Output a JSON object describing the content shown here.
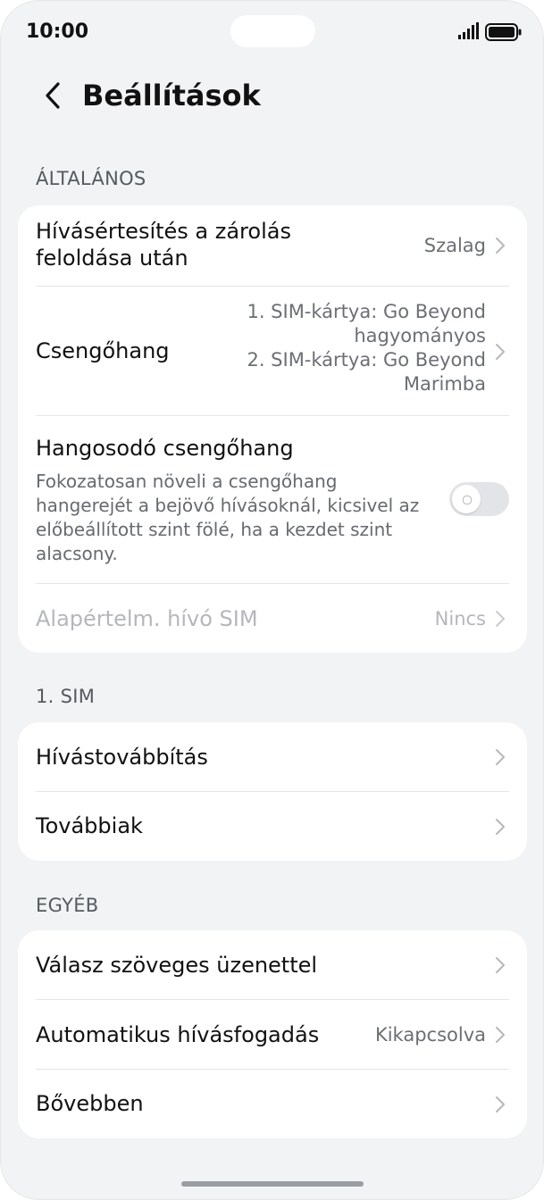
{
  "status_bar": {
    "time": "10:00",
    "signal_icon": "cellular-signal-icon",
    "battery_icon": "battery-full-icon"
  },
  "header": {
    "title": "Beállítások",
    "back_icon": "chevron-left-icon"
  },
  "sections": {
    "general": {
      "label": "ÁLTALÁNOS",
      "items": {
        "notification": {
          "title_line1": "Hívásértesítés a zárolás",
          "title_line2": "feloldása után",
          "value": "Szalag"
        },
        "ringtone": {
          "title": "Csengőhang",
          "value_line1": "1. SIM-kártya: Go Beyond",
          "value_line2": "hagyományos",
          "value_line3": "2. SIM-kártya: Go Beyond",
          "value_line4": "Marimba"
        },
        "rising_ringtone": {
          "title": "Hangosodó csengőhang",
          "desc_line1": "Fokozatosan növeli a csengőhang",
          "desc_line2": "hangerejét a bejövő hívásoknál, kicsivel az",
          "desc_line3": "előbeállított szint fölé, ha a kezdet szint",
          "desc_line4": "alacsony.",
          "enabled": false
        },
        "default_sim": {
          "title": "Alapértelm. hívó SIM",
          "value": "Nincs"
        }
      }
    },
    "sim1": {
      "label": "1. SIM",
      "items": {
        "forwarding": {
          "title": "Hívástovábbítás"
        },
        "more": {
          "title": "Továbbiak"
        }
      }
    },
    "other": {
      "label": "EGYÉB",
      "items": {
        "sms_reply": {
          "title": "Válasz szöveges üzenettel"
        },
        "auto_answer": {
          "title": "Automatikus hívásfogadás",
          "value": "Kikapcsolva"
        },
        "more": {
          "title": "Bővebben"
        }
      }
    }
  },
  "colors": {
    "background": "#f1f3f5",
    "card": "#ffffff",
    "text_primary": "#111111",
    "text_secondary": "#6b6f74",
    "text_disabled": "#b4b7bb"
  }
}
